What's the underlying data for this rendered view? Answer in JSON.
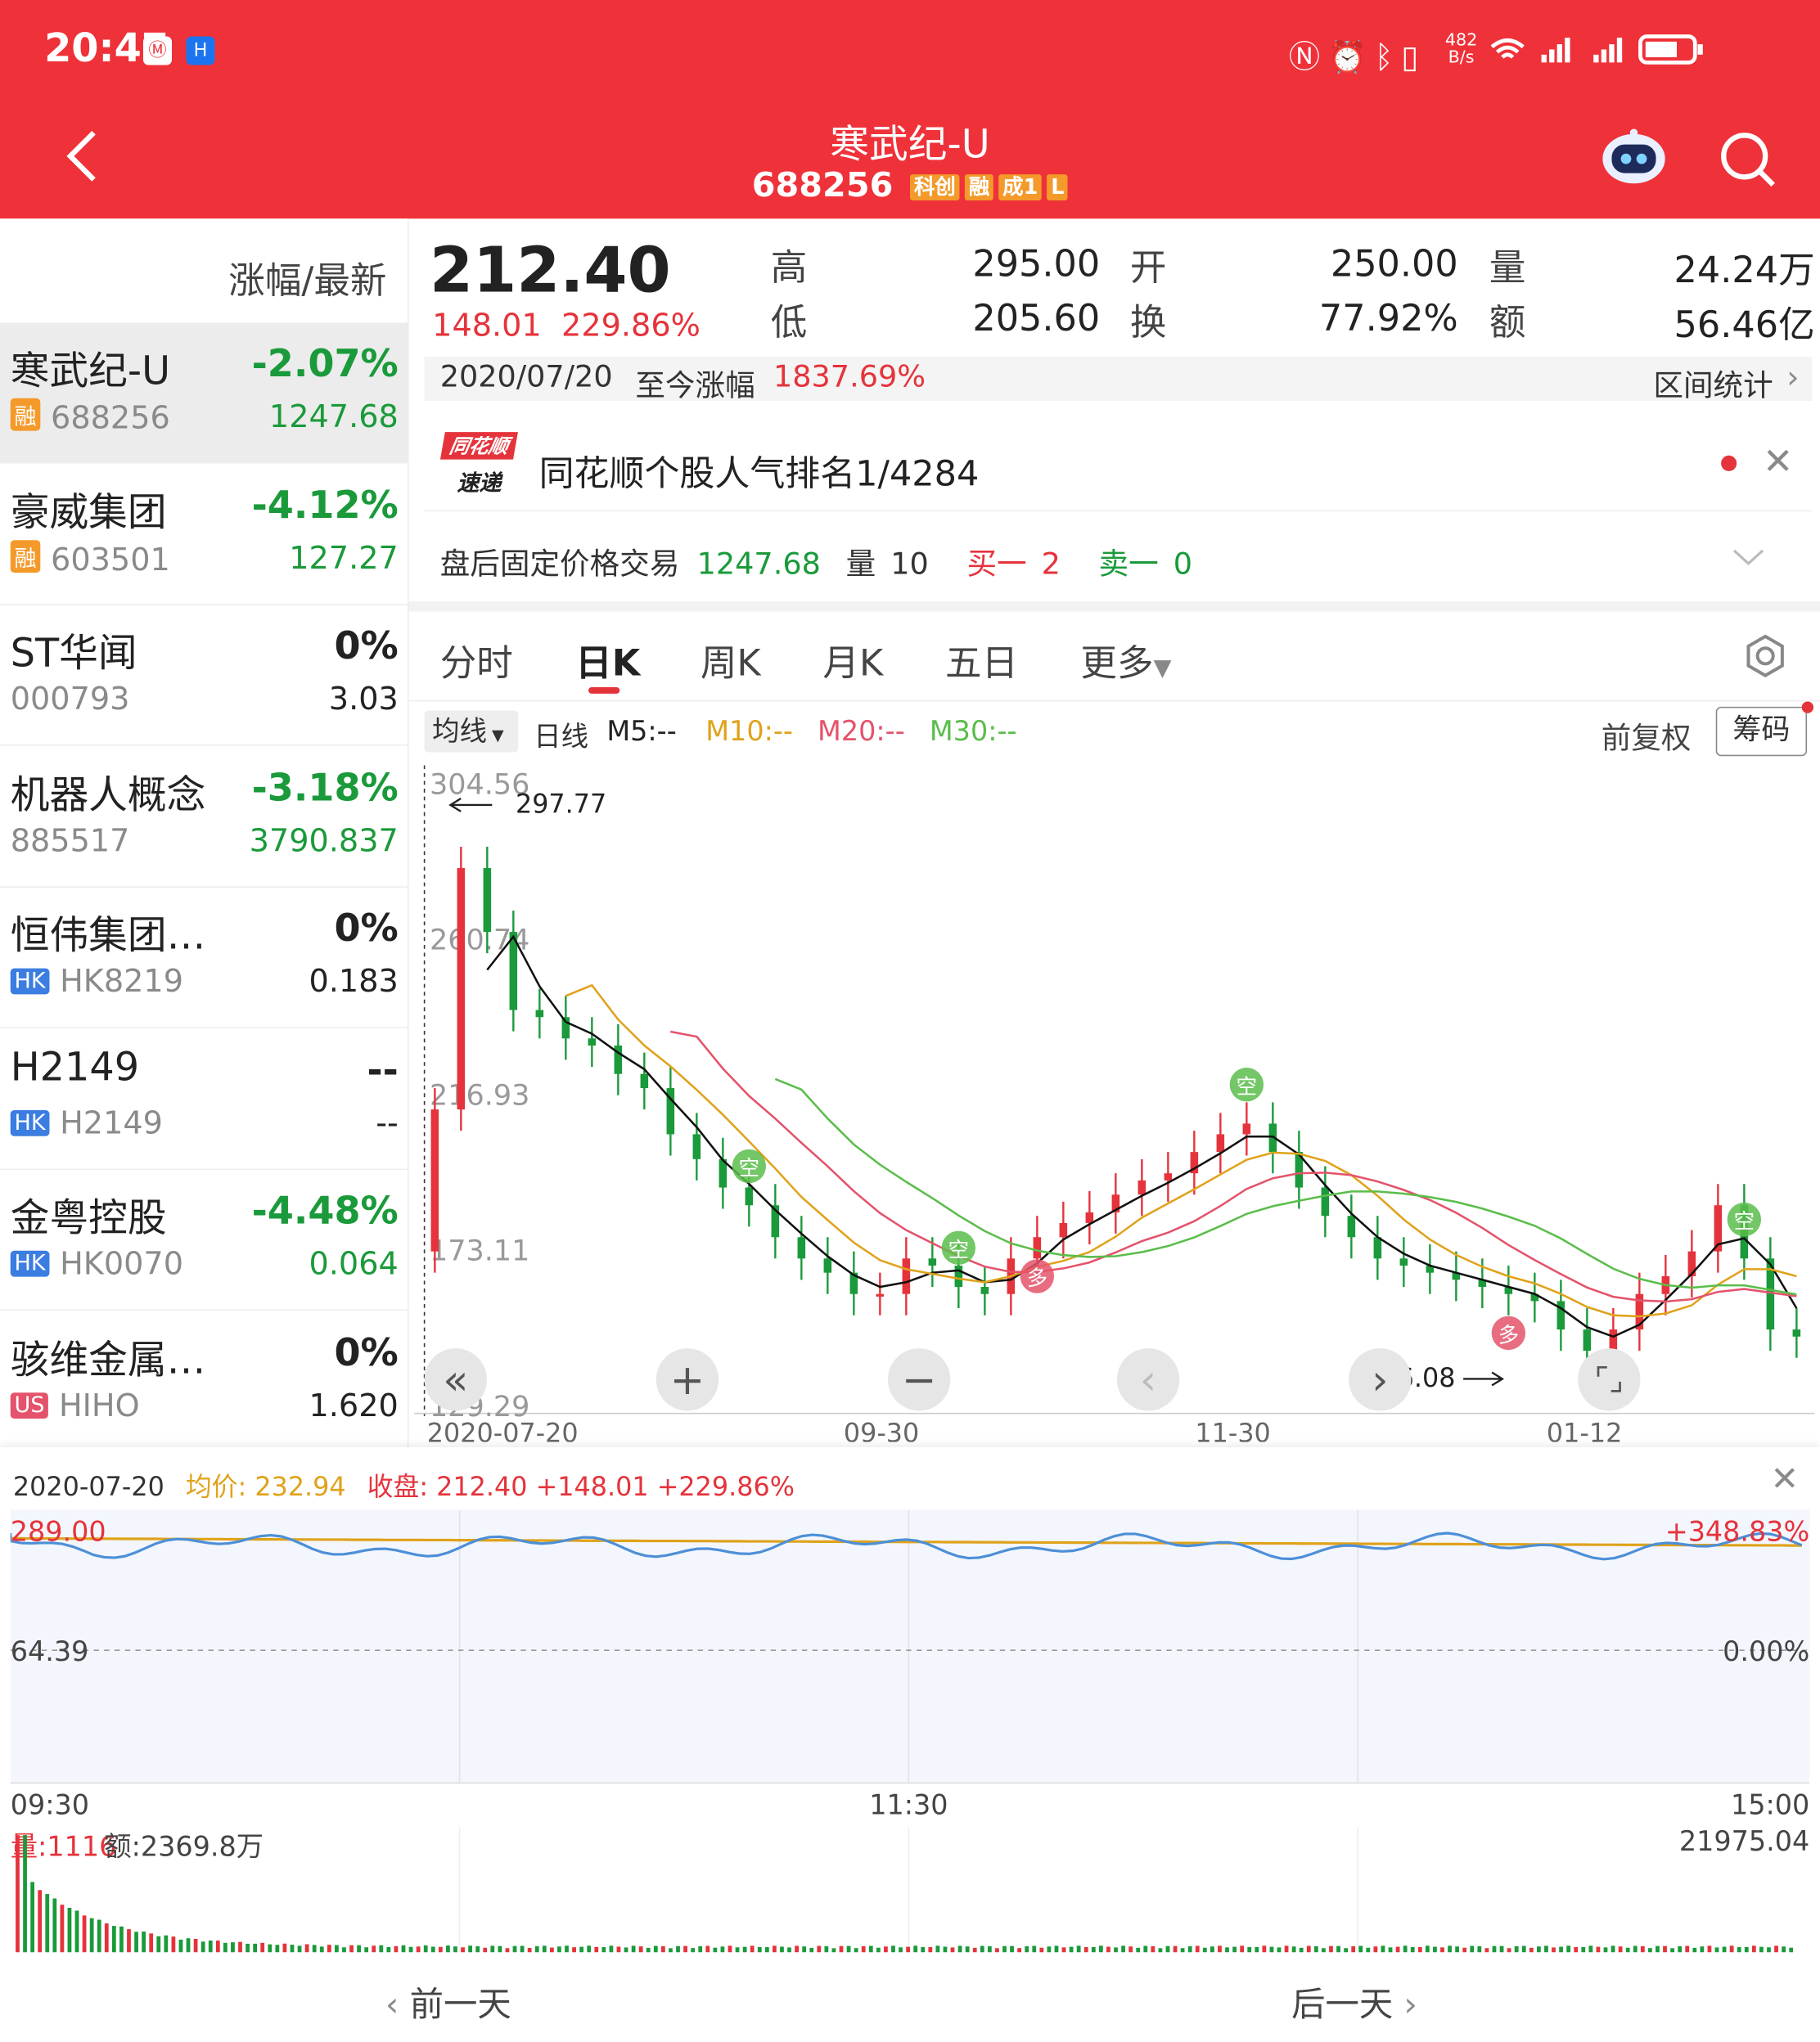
{
  "status": {
    "time": "20:47",
    "net_speed_top": "482",
    "net_speed_bottom": "B/s",
    "icons": [
      "nfc-icon",
      "alarm-icon",
      "bluetooth-icon",
      "vibrate-icon",
      "wifi-icon",
      "signal-icon",
      "battery-icon"
    ]
  },
  "header": {
    "title": "寒武纪-U",
    "code": "688256",
    "tags": [
      "科创",
      "融",
      "成1",
      "L"
    ],
    "robot": "robot-icon",
    "search": "search-icon"
  },
  "watchlist": {
    "header": "涨幅/最新",
    "items": [
      {
        "name": "寒武纪-U",
        "tag": "融",
        "code": "688256",
        "pct": "-2.07%",
        "price": "1247.68",
        "color": "#1a9a3a"
      },
      {
        "name": "豪威集团",
        "tag": "融",
        "code": "603501",
        "pct": "-4.12%",
        "price": "127.27",
        "color": "#1a9a3a"
      },
      {
        "name": "ST华闻",
        "tag": "",
        "code": "000793",
        "pct": "0%",
        "price": "3.03",
        "color": "#222222"
      },
      {
        "name": "机器人概念",
        "tag": "",
        "code": "885517",
        "pct": "-3.18%",
        "price": "3790.837",
        "color": "#1a9a3a"
      },
      {
        "name": "恒伟集团…",
        "tag": "HK",
        "code": "HK8219",
        "pct": "0%",
        "price": "0.183",
        "color": "#222222"
      },
      {
        "name": "H2149",
        "tag": "HK",
        "code": "H2149",
        "pct": "--",
        "price": "--",
        "color": "#222222"
      },
      {
        "name": "金粤控股",
        "tag": "HK",
        "code": "HK0070",
        "pct": "-4.48%",
        "price": "0.064",
        "color": "#1a9a3a"
      },
      {
        "name": "骇维金属…",
        "tag": "US",
        "code": "HIHO",
        "pct": "0%",
        "price": "1.620",
        "color": "#222222"
      }
    ]
  },
  "quote": {
    "price": "212.40",
    "change": "148.01",
    "change_pct": "229.86%",
    "high_label": "高",
    "high": "295.00",
    "open_label": "开",
    "open": "250.00",
    "vol_label": "量",
    "vol": "24.24万",
    "low_label": "低",
    "low": "205.60",
    "turnover_label": "换",
    "turnover": "77.92%",
    "amount_label": "额",
    "amount": "56.46亿"
  },
  "range": {
    "date": "2020/07/20",
    "label": "至今涨幅",
    "value": "1837.69%",
    "stats": "区间统计"
  },
  "news": {
    "logo_top": "同花顺",
    "logo_bottom": "速递",
    "text": "同花顺个股人气排名1/4284"
  },
  "afterhours": {
    "label": "盘后固定价格交易",
    "price": "1247.68",
    "vol_label": "量",
    "vol": "10",
    "buy_label": "买一",
    "buy": "2",
    "sell_label": "卖一",
    "sell": "0"
  },
  "tabs": [
    "分时",
    "日K",
    "周K",
    "月K",
    "五日",
    "更多"
  ],
  "ma_bar": {
    "select": "均线",
    "type": "日线",
    "m5": "M5:--",
    "m10": "M10:--",
    "m20": "M20:--",
    "m30": "M30:--",
    "fq": "前复权",
    "chip": "筹码"
  },
  "kchart": {
    "y_labels": [
      "304.56",
      "260.74",
      "216.93",
      "173.11",
      "129.29"
    ],
    "max_label": "297.77",
    "min_label": "136.08",
    "x_labels": [
      "2020-07-20",
      "09-30",
      "11-30",
      "01-12"
    ],
    "ma_colors": {
      "m5": "#111111",
      "m10": "#e0a21b",
      "m20": "#e4536b",
      "m30": "#5bbd4b"
    }
  },
  "intraday": {
    "date": "2020-07-20",
    "avg_label": "均价:",
    "avg": "232.94",
    "close_label": "收盘:",
    "close": "212.40",
    "change": "+148.01",
    "change_pct": "+229.86%",
    "y_top": "289.00",
    "y_mid": "64.39",
    "pct_top": "+348.83%",
    "pct_mid": "0.00%",
    "x_labels": [
      "09:30",
      "11:30",
      "15:00"
    ],
    "vol_label": "量:1116",
    "amt_label": "额:2369.8万",
    "vol_max": "21975.04"
  },
  "nav": {
    "prev": "前一天",
    "next": "后一天"
  },
  "chart_data": {
    "type": "candlestick",
    "title": "寒武纪-U 日K",
    "y_range": [
      129.29,
      304.56
    ],
    "max": 297.77,
    "min": 136.08,
    "x_labels": [
      "2020-07-20",
      "09-30",
      "11-30",
      "01-12"
    ],
    "series": [
      {
        "name": "M5",
        "color": "#111111"
      },
      {
        "name": "M10",
        "color": "#e0a21b"
      },
      {
        "name": "M20",
        "color": "#e4536b"
      },
      {
        "name": "M30",
        "color": "#5bbd4b"
      }
    ],
    "approx_closes": [
      212,
      280,
      262,
      240,
      238,
      232,
      230,
      222,
      218,
      205,
      198,
      190,
      185,
      176,
      170,
      166,
      160,
      160,
      170,
      168,
      162,
      160,
      170,
      176,
      180,
      183,
      188,
      192,
      194,
      200,
      205,
      208,
      200,
      190,
      182,
      176,
      170,
      168,
      166,
      164,
      162,
      160,
      158,
      150,
      144,
      150,
      160,
      165,
      172,
      185,
      170,
      150,
      148
    ]
  }
}
